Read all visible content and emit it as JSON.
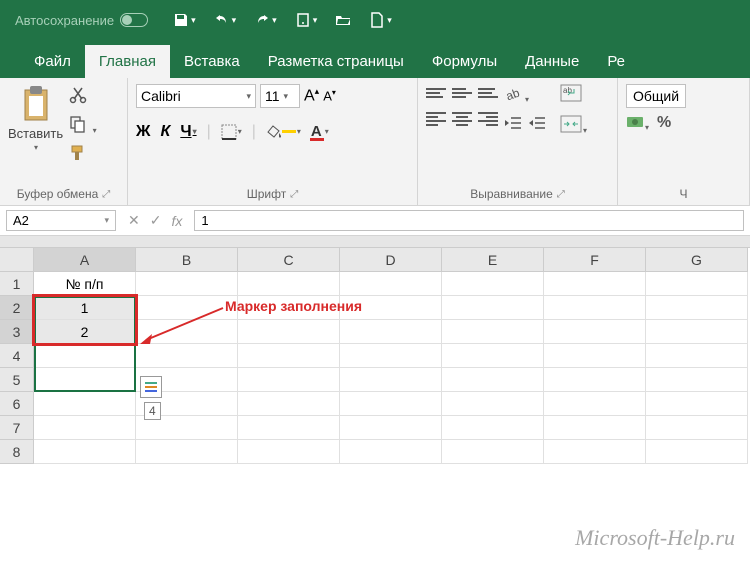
{
  "titlebar": {
    "autosave": "Автосохранение"
  },
  "tabs": {
    "file": "Файл",
    "home": "Главная",
    "insert": "Вставка",
    "layout": "Разметка страницы",
    "formulas": "Формулы",
    "data": "Данные",
    "review": "Ре"
  },
  "ribbon": {
    "clipboard": {
      "paste": "Вставить",
      "label": "Буфер обмена"
    },
    "font": {
      "name": "Calibri",
      "size": "11",
      "bold": "Ж",
      "italic": "К",
      "underline": "Ч",
      "label": "Шрифт"
    },
    "alignment": {
      "label": "Выравнивание"
    },
    "number": {
      "format": "Общий",
      "label": "Ч"
    }
  },
  "formula_bar": {
    "name_box": "A2",
    "fx": "fx",
    "value": "1"
  },
  "grid": {
    "columns": [
      "A",
      "B",
      "C",
      "D",
      "E",
      "F",
      "G"
    ],
    "rows": [
      "1",
      "2",
      "3",
      "4",
      "5",
      "6",
      "7",
      "8"
    ],
    "cells": {
      "A1": "№ п/п",
      "A2": "1",
      "A3": "2"
    },
    "tooltip": "4"
  },
  "annotation": "Маркер заполнения",
  "watermark": "Microsoft-Help.ru"
}
